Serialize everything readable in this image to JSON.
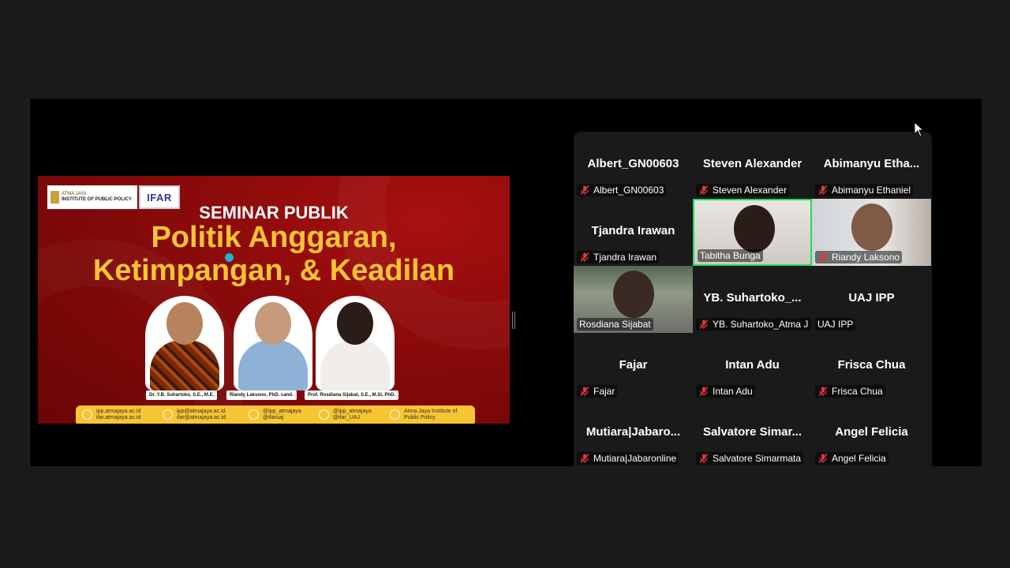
{
  "slide": {
    "logo_ipp_line1": "ATMA JAYA",
    "logo_ipp_line2": "INSTITUTE OF PUBLIC POLICY",
    "logo_ifar": "IFAR",
    "seminar_title": "SEMINAR PUBLIK",
    "headline_line1": "Politik Anggaran,",
    "headline_line2": "Ketimpangan, & Keadilan",
    "speakers": [
      {
        "name": "Dr. Y.B. Suhartoko, S.E., M.E."
      },
      {
        "name": "Riandy Laksono, PhD. cand."
      },
      {
        "name": "Prof. Rosdiana Sijabat, S.E., M.Si, PhD."
      }
    ],
    "contacts": [
      {
        "line1": "ipp.atmajaya.ac.id",
        "line2": "ifar.atmajaya.ac.id"
      },
      {
        "line1": "ipp@atmajaya.ac.id",
        "line2": "ifar@atmajaya.ac.id"
      },
      {
        "line1": "@ipp_atmajaya",
        "line2": "@ifaruaj"
      },
      {
        "line1": "@ipp_atmajaya",
        "line2": "@ifar_UAJ"
      },
      {
        "line1": "Atma Jaya Institute of",
        "line2": "Public Policy"
      }
    ]
  },
  "participants": [
    {
      "display": "Albert_GN00603",
      "label": "Albert_GN00603",
      "muted": true
    },
    {
      "display": "Steven Alexander",
      "label": "Steven Alexander",
      "muted": true
    },
    {
      "display": "Abimanyu  Etha...",
      "label": "Abimanyu Ethaniel",
      "muted": true
    },
    {
      "display": "Tjandra Irawan",
      "label": "Tjandra Irawan",
      "muted": true
    },
    {
      "display": "",
      "label": "Tabitha Bunga",
      "muted": false,
      "video": true,
      "speaking": true
    },
    {
      "display": "",
      "label": "Riandy Laksono",
      "muted": true,
      "video": true
    },
    {
      "display": "",
      "label": "Rosdiana Sijabat",
      "muted": false,
      "video": true
    },
    {
      "display": "YB.  Suhartoko_...",
      "label": "YB. Suhartoko_Atma Ja...",
      "muted": true
    },
    {
      "display": "UAJ IPP",
      "label": "UAJ IPP",
      "muted": false
    },
    {
      "display": "Fajar",
      "label": "Fajar",
      "muted": true
    },
    {
      "display": "Intan Adu",
      "label": "Intan Adu",
      "muted": true
    },
    {
      "display": "Frisca Chua",
      "label": "Frisca Chua",
      "muted": true
    },
    {
      "display": "Mutiara|Jabaro...",
      "label": "Mutiara|Jabaronline",
      "muted": true
    },
    {
      "display": "Salvatore  Simar...",
      "label": "Salvatore Simarmata",
      "muted": true
    },
    {
      "display": "Angel Felicia",
      "label": "Angel Felicia",
      "muted": true
    }
  ],
  "colors": {
    "slide_red": "#8f0b0b",
    "headline_yellow": "#f7c533",
    "speaking_border": "#23d962",
    "muted_mic": "#e0383e"
  }
}
